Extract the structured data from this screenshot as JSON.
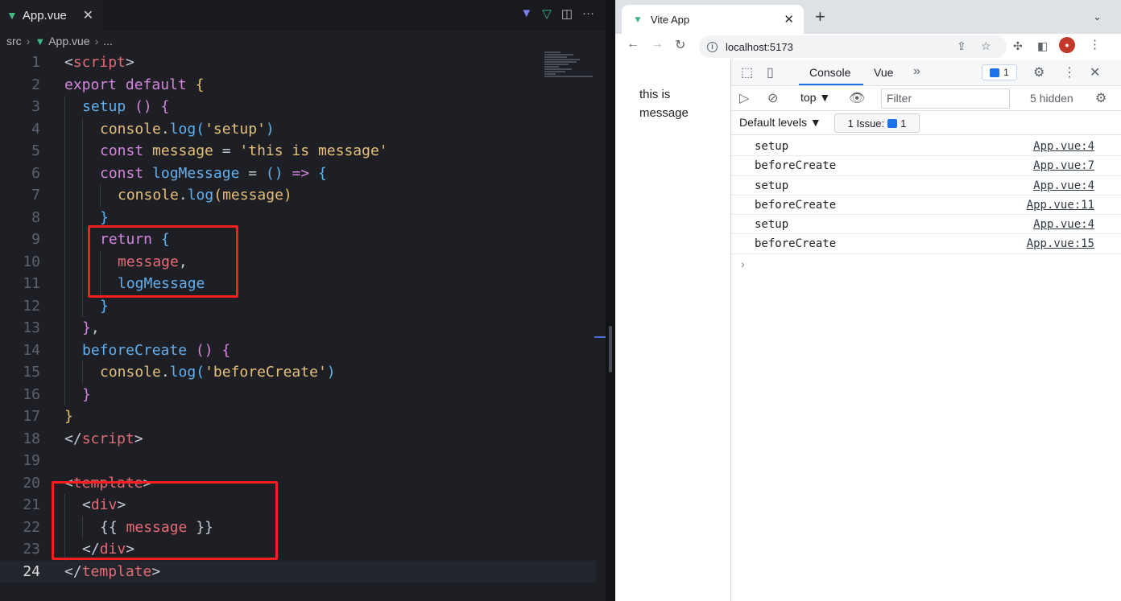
{
  "editor": {
    "tab": {
      "label": "App.vue",
      "close": "✕"
    },
    "breadcrumb": {
      "folder": "src",
      "file": "App.vue",
      "more": "..."
    },
    "lines": [
      {
        "n": "1",
        "indent": 0,
        "tokens": [
          [
            "t-punc",
            "<"
          ],
          [
            "t-tag",
            "script"
          ],
          [
            "t-punc",
            ">"
          ]
        ]
      },
      {
        "n": "2",
        "indent": 0,
        "tokens": [
          [
            "t-kw",
            "export default "
          ],
          [
            "t-br1",
            "{"
          ]
        ]
      },
      {
        "n": "3",
        "indent": 1,
        "tokens": [
          [
            "t-fn",
            "setup "
          ],
          [
            "t-br2",
            "() {"
          ]
        ]
      },
      {
        "n": "4",
        "indent": 2,
        "tokens": [
          [
            "t-var",
            "console"
          ],
          [
            "t-punc",
            "."
          ],
          [
            "t-fn",
            "log"
          ],
          [
            "t-br3",
            "("
          ],
          [
            "t-str",
            "'setup'"
          ],
          [
            "t-br3",
            ")"
          ]
        ]
      },
      {
        "n": "5",
        "indent": 2,
        "tokens": [
          [
            "t-kw",
            "const "
          ],
          [
            "t-var",
            "message"
          ],
          [
            "t-punc",
            " = "
          ],
          [
            "t-str",
            "'this is message'"
          ]
        ]
      },
      {
        "n": "6",
        "indent": 2,
        "tokens": [
          [
            "t-kw",
            "const "
          ],
          [
            "t-fn",
            "logMessage"
          ],
          [
            "t-punc",
            " = "
          ],
          [
            "t-br3",
            "()"
          ],
          [
            "t-kw",
            " => "
          ],
          [
            "t-br3",
            "{"
          ]
        ]
      },
      {
        "n": "7",
        "indent": 3,
        "tokens": [
          [
            "t-var",
            "console"
          ],
          [
            "t-punc",
            "."
          ],
          [
            "t-fn",
            "log"
          ],
          [
            "t-br1",
            "("
          ],
          [
            "t-var",
            "message"
          ],
          [
            "t-br1",
            ")"
          ]
        ]
      },
      {
        "n": "8",
        "indent": 2,
        "tokens": [
          [
            "t-br3",
            "}"
          ]
        ]
      },
      {
        "n": "9",
        "indent": 2,
        "tokens": [
          [
            "t-kw",
            "return "
          ],
          [
            "t-br3",
            "{"
          ]
        ]
      },
      {
        "n": "10",
        "indent": 3,
        "tokens": [
          [
            "t-prop",
            "message"
          ],
          [
            "t-punc",
            ","
          ]
        ]
      },
      {
        "n": "11",
        "indent": 3,
        "tokens": [
          [
            "t-fn",
            "logMessage"
          ]
        ]
      },
      {
        "n": "12",
        "indent": 2,
        "tokens": [
          [
            "t-br3",
            "}"
          ]
        ]
      },
      {
        "n": "13",
        "indent": 1,
        "tokens": [
          [
            "t-br2",
            "}"
          ],
          [
            "t-punc",
            ","
          ]
        ]
      },
      {
        "n": "14",
        "indent": 1,
        "tokens": [
          [
            "t-fn",
            "beforeCreate "
          ],
          [
            "t-br2",
            "() {"
          ]
        ]
      },
      {
        "n": "15",
        "indent": 2,
        "tokens": [
          [
            "t-var",
            "console"
          ],
          [
            "t-punc",
            "."
          ],
          [
            "t-fn",
            "log"
          ],
          [
            "t-br3",
            "("
          ],
          [
            "t-str",
            "'beforeCreate'"
          ],
          [
            "t-br3",
            ")"
          ]
        ]
      },
      {
        "n": "16",
        "indent": 1,
        "tokens": [
          [
            "t-br2",
            "}"
          ]
        ]
      },
      {
        "n": "17",
        "indent": 0,
        "tokens": [
          [
            "t-br1",
            "}"
          ]
        ]
      },
      {
        "n": "18",
        "indent": 0,
        "tokens": [
          [
            "t-punc",
            "</"
          ],
          [
            "t-tag",
            "script"
          ],
          [
            "t-punc",
            ">"
          ]
        ]
      },
      {
        "n": "19",
        "indent": 0,
        "tokens": []
      },
      {
        "n": "20",
        "indent": 0,
        "tokens": [
          [
            "t-punc",
            "<"
          ],
          [
            "t-tag",
            "template"
          ],
          [
            "t-punc",
            ">"
          ]
        ]
      },
      {
        "n": "21",
        "indent": 1,
        "tokens": [
          [
            "t-punc",
            "<"
          ],
          [
            "t-tag",
            "div"
          ],
          [
            "t-punc",
            ">"
          ]
        ]
      },
      {
        "n": "22",
        "indent": 2,
        "tokens": [
          [
            "t-punc",
            "{{ "
          ],
          [
            "t-prop",
            "message"
          ],
          [
            "t-punc",
            " }}"
          ]
        ]
      },
      {
        "n": "23",
        "indent": 1,
        "tokens": [
          [
            "t-punc",
            "</"
          ],
          [
            "t-tag",
            "div"
          ],
          [
            "t-punc",
            ">"
          ]
        ]
      },
      {
        "n": "24",
        "indent": 0,
        "tokens": [
          [
            "t-punc",
            "</"
          ],
          [
            "t-tag",
            "template"
          ],
          [
            "t-punc",
            ">"
          ]
        ]
      }
    ],
    "current_line": "24",
    "highlight_color": "#ff1e1e"
  },
  "browser": {
    "tab": {
      "title": "Vite App",
      "close": "✕"
    },
    "new_tab": "+",
    "address": "localhost:5173",
    "page_message": "this is message",
    "devtools": {
      "tabs": [
        "Console",
        "Vue"
      ],
      "more_tabs": "»",
      "message_count": "1",
      "context": "top ▼",
      "filter_placeholder": "Filter",
      "hidden": "5 hidden",
      "levels": "Default levels ▼",
      "issues_label": "1 Issue:",
      "issues_count": "1",
      "logs": [
        {
          "msg": "setup",
          "src": "App.vue:4"
        },
        {
          "msg": "beforeCreate",
          "src": "App.vue:7"
        },
        {
          "msg": "setup",
          "src": "App.vue:4"
        },
        {
          "msg": "beforeCreate",
          "src": "App.vue:11"
        },
        {
          "msg": "setup",
          "src": "App.vue:4"
        },
        {
          "msg": "beforeCreate",
          "src": "App.vue:15"
        }
      ],
      "prompt": "›"
    }
  }
}
